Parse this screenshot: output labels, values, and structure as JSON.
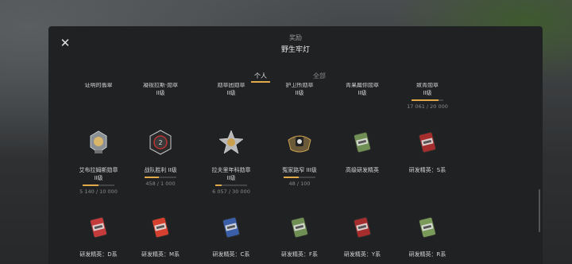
{
  "header": {
    "subtitle": "奖励",
    "title": "野生牢灯"
  },
  "tabs": [
    {
      "label": "个人",
      "active": true
    },
    {
      "label": "全部",
      "active": false
    }
  ],
  "top_row": [
    {
      "name_line1": "证明的翡翠",
      "name_line2": ""
    },
    {
      "name_line1": "凝视拉斯·勋章",
      "name_line2": "II级"
    },
    {
      "name_line1": "勋章团勋章",
      "name_line2": "II级"
    },
    {
      "name_line1": "护卫所勋章",
      "name_line2": "II级"
    },
    {
      "name_line1": "青果扁你勋章",
      "name_line2": "II级"
    },
    {
      "name_line1": "致青勋章",
      "name_line2": "II级",
      "progress": "17 061 / 20 000",
      "progress_fraction": 0.85
    }
  ],
  "middle_row": [
    {
      "icon": "medal-icon",
      "name_line1": "艾布拉姆斯勋章",
      "name_line2": "II级",
      "progress": "5 140 / 10 000",
      "progress_fraction": 0.51
    },
    {
      "icon": "badge-icon",
      "name_line1": "战队胜利 II级",
      "name_line2": "",
      "progress": "458 / 1 000",
      "progress_fraction": 0.46
    },
    {
      "icon": "star-medal-icon",
      "name_line1": "拉夫里年科勋章",
      "name_line2": "II级",
      "progress": "6 057 / 30 000",
      "progress_fraction": 0.2
    },
    {
      "icon": "fist-emblem-icon",
      "name_line1": "冤家路窄 III级",
      "name_line2": "",
      "progress": "48 / 100",
      "progress_fraction": 0.48
    },
    {
      "icon": "card-icon",
      "name_line1": "高级研发精英",
      "name_line2": ""
    },
    {
      "icon": "card-icon",
      "name_line1": "研发精英：S系",
      "name_line2": ""
    }
  ],
  "bottom_row": [
    {
      "icon": "card-icon",
      "name_line1": "研发精英：D系"
    },
    {
      "icon": "card-icon",
      "name_line1": "研发精英：M系"
    },
    {
      "icon": "card-icon",
      "name_line1": "研发精英：C系"
    },
    {
      "icon": "card-icon",
      "name_line1": "研发精英：F系"
    },
    {
      "icon": "card-icon",
      "name_line1": "研发精英：Y系"
    },
    {
      "icon": "card-icon",
      "name_line1": "研发精英：R系"
    }
  ],
  "colors": {
    "accent": "#e0a94a",
    "panel": "#1f2123"
  }
}
